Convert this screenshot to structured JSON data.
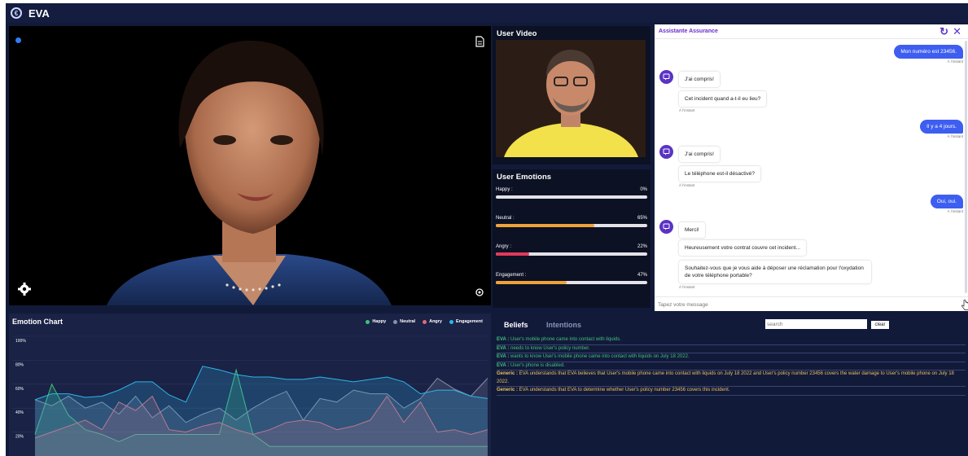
{
  "app": {
    "title": "EVA",
    "logo_glyph": "€"
  },
  "user_video": {
    "title": "User Video"
  },
  "emotions": {
    "title": "User Emotions",
    "items": [
      {
        "label": "Happy :",
        "pct_text": "0%",
        "value": 0,
        "color": "#f0a23a"
      },
      {
        "label": "Neutral :",
        "pct_text": "65%",
        "value": 65,
        "color": "#f0a23a"
      },
      {
        "label": "Angry :",
        "pct_text": "22%",
        "value": 22,
        "color": "#e03a5a"
      },
      {
        "label": "Engagement :",
        "pct_text": "47%",
        "value": 47,
        "color": "#f0a23a"
      }
    ]
  },
  "chat": {
    "title": "Assistante Assurance",
    "input_placeholder": "Tapez votre message",
    "messages": [
      {
        "from": "user",
        "text": "Mon numéro est 23456.",
        "ts": "À l'instant"
      },
      {
        "from": "bot",
        "text": "J'ai compris!"
      },
      {
        "from": "bot",
        "text": "Cet incident quand a-t-il eu lieu?",
        "ts": "À l'instant"
      },
      {
        "from": "user",
        "text": "Il y a 4 jours.",
        "ts": "À l'instant"
      },
      {
        "from": "bot",
        "text": "J'ai compris!"
      },
      {
        "from": "bot",
        "text": "Le téléphone est-il désactivé?",
        "ts": "À l'instant"
      },
      {
        "from": "user",
        "text": "Oui, oui.",
        "ts": "À l'instant"
      },
      {
        "from": "bot",
        "text": "Merci!"
      },
      {
        "from": "bot",
        "text": "Heureusement votre contrat couvre cet incident..."
      },
      {
        "from": "bot",
        "text": "Souhaitez-vous que je vous aide à déposer une réclamation pour l'oxydation de votre téléphone portable?",
        "ts": "À l'instant"
      }
    ]
  },
  "chart_data": {
    "type": "area",
    "title": "Emotion Chart",
    "x": [
      0,
      1,
      2,
      3,
      4,
      5,
      6,
      7,
      8,
      9,
      10,
      11,
      12,
      13,
      14,
      15,
      16,
      17,
      18,
      19,
      20,
      21,
      22,
      23,
      24,
      25,
      26,
      27
    ],
    "ylim": [
      0,
      100
    ],
    "yticks": [
      "20%",
      "40%",
      "60%",
      "80%",
      "100%"
    ],
    "legend_position": "top-right",
    "series": [
      {
        "name": "Happy",
        "color": "#3fc17a",
        "values": [
          18,
          60,
          34,
          22,
          18,
          12,
          18,
          18,
          18,
          18,
          18,
          18,
          72,
          18,
          8,
          8,
          8,
          8,
          8,
          8,
          8,
          8,
          8,
          8,
          8,
          8,
          8,
          8
        ]
      },
      {
        "name": "Neutral",
        "color": "#8a8fa8",
        "values": [
          47,
          42,
          50,
          40,
          45,
          35,
          50,
          32,
          42,
          28,
          35,
          40,
          30,
          40,
          48,
          54,
          30,
          48,
          45,
          55,
          52,
          52,
          40,
          48,
          65,
          56,
          50,
          65
        ]
      },
      {
        "name": "Angry",
        "color": "#e06a7a",
        "values": [
          15,
          20,
          25,
          30,
          22,
          45,
          38,
          50,
          22,
          20,
          25,
          28,
          22,
          18,
          22,
          28,
          30,
          28,
          22,
          25,
          30,
          50,
          28,
          45,
          20,
          22,
          18,
          22
        ]
      },
      {
        "name": "Engagement",
        "color": "#2fb6e8",
        "values": [
          47,
          52,
          52,
          49,
          50,
          55,
          62,
          62,
          51,
          45,
          75,
          72,
          68,
          66,
          66,
          64,
          64,
          66,
          64,
          62,
          64,
          66,
          62,
          52,
          55,
          55,
          50,
          48
        ]
      }
    ]
  },
  "beliefs": {
    "tabs": [
      "Beliefs",
      "Intentions"
    ],
    "search_placeholder": "search",
    "clear_label": "clear",
    "items": [
      {
        "src": "EVA :",
        "text": "User's mobile phone came into contact with liquids.",
        "color": "#3fc17a"
      },
      {
        "src": "EVA :",
        "text": "needs to know User's policy number.",
        "color": "#3fc17a"
      },
      {
        "src": "EVA :",
        "text": "wants to know User's mobile phone came into contact with liquids on July 18 2022.",
        "color": "#3fc17a"
      },
      {
        "src": "EVA :",
        "text": "User's phone is disabled.",
        "color": "#3fc17a"
      },
      {
        "src": "Generic :",
        "text": "EVA understands that EVA believes that User's mobile phone came into contact with liquids on July 18 2022 and User's policy number 23456 covers the water damage to User's mobile phone on July 18 2022.",
        "color": "#e8c15a"
      },
      {
        "src": "Generic :",
        "text": "EVA understands that EVA to determine whether User's policy number 23456 covers this incident.",
        "color": "#e8c15a"
      }
    ]
  }
}
